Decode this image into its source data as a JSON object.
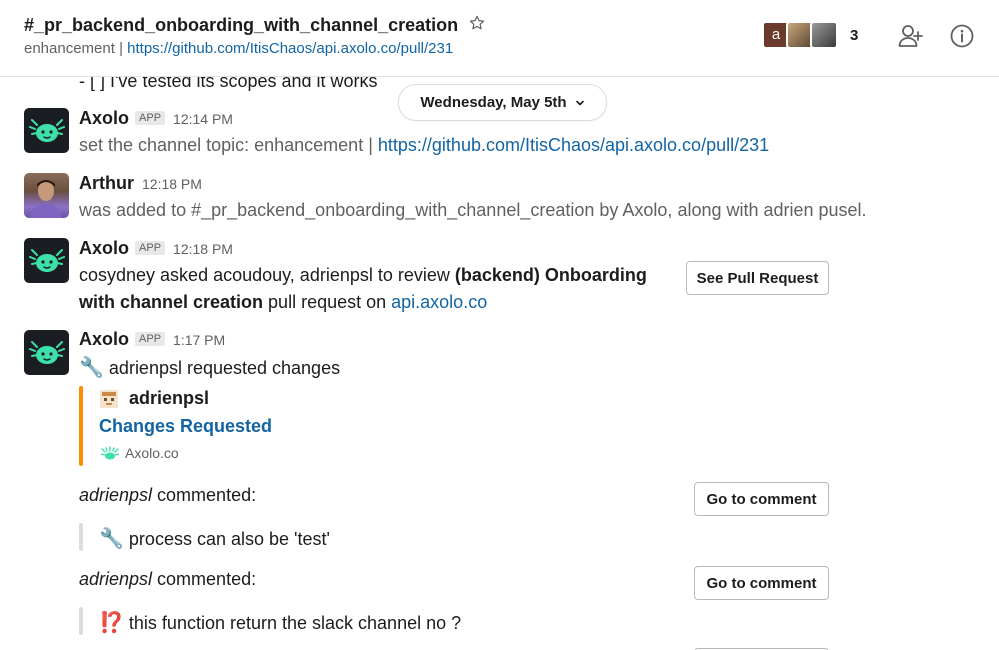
{
  "header": {
    "channel_name": "#_pr_backend_onboarding_with_channel_creation",
    "topic_label": "enhancement",
    "topic_separator": "|",
    "topic_link": "https://github.com/ItisChaos/api.axolo.co/pull/231",
    "member_count": "3",
    "member_avatar_initial": "a"
  },
  "date_divider": {
    "label": "Wednesday, May 5th"
  },
  "messages": {
    "prev_tail": "- [ ] I've tested its scopes and it works",
    "m1": {
      "author": "Axolo",
      "badge": "APP",
      "time": "12:14 PM",
      "text_prefix": "set the channel topic: enhancement |",
      "link": "https://github.com/ItisChaos/api.axolo.co/pull/231"
    },
    "m2": {
      "author": "Arthur",
      "time": "12:18 PM",
      "text": "was added to #_pr_backend_onboarding_with_channel_creation by Axolo, along with adrien pusel."
    },
    "m3": {
      "author": "Axolo",
      "badge": "APP",
      "time": "12:18 PM",
      "line1_prefix": "cosydney asked acoudouy, adrienpsl to review ",
      "line1_bold": "(backend) Onboarding",
      "line2_bold": "with channel creation",
      "line2_mid": " pull request on ",
      "line2_link": "api.axolo.co",
      "button": "See Pull Request"
    },
    "m4": {
      "author": "Axolo",
      "badge": "APP",
      "time": "1:17 PM",
      "emoji": "🔧",
      "text": "adrienpsl requested changes",
      "attachment_author": "adrienpsl",
      "attachment_title": "Changes Requested",
      "attachment_footer": "Axolo.co"
    },
    "c1": {
      "commenter": "adrienpsl",
      "suffix": " commented:",
      "button": "Go to comment",
      "emoji": "🔧",
      "quote": "process can also be 'test'"
    },
    "c2": {
      "commenter": "adrienpsl",
      "suffix": " commented:",
      "button": "Go to comment",
      "emoji": "⁉️",
      "quote": "this function return the slack channel no ?"
    }
  },
  "colors": {
    "link": "#1264a3",
    "attachment_bar": "#ff8c00",
    "quote_bar": "#dddddd",
    "axolo_avatar_bg": "#1a1d21",
    "axolo_green": "#3de0a8"
  },
  "icons": {
    "star": "star-icon",
    "add_member": "add-member-icon",
    "info": "info-icon",
    "chevron": "chevron-down-icon"
  }
}
